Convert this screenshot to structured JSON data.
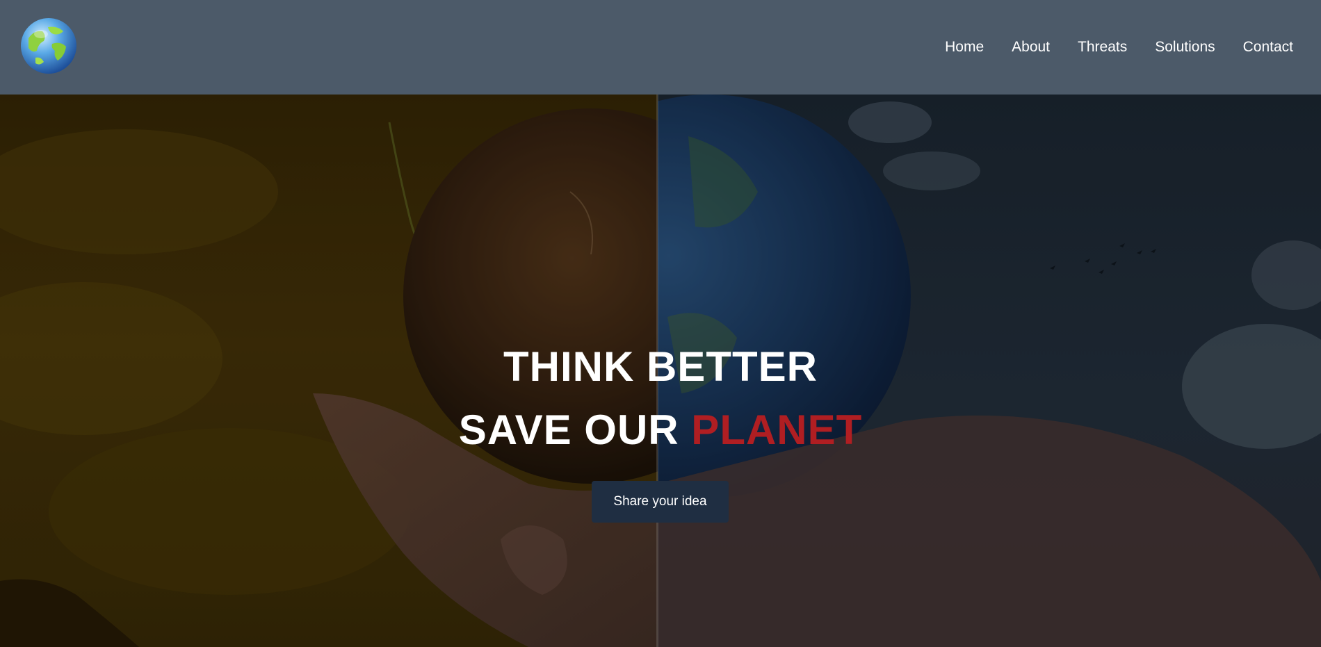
{
  "header": {
    "logo_icon": "globe-icon",
    "nav": [
      {
        "label": "Home"
      },
      {
        "label": "About"
      },
      {
        "label": "Threats"
      },
      {
        "label": "Solutions"
      },
      {
        "label": "Contact"
      }
    ],
    "background_color": "#4c5a69"
  },
  "hero": {
    "title_line1": "THINK BETTER",
    "title_line2_prefix": "SAVE OUR ",
    "title_line2_accent": "PLANET",
    "cta_label": "Share your idea",
    "accent_color": "#b01e22",
    "button_color": "#1f2e42"
  }
}
